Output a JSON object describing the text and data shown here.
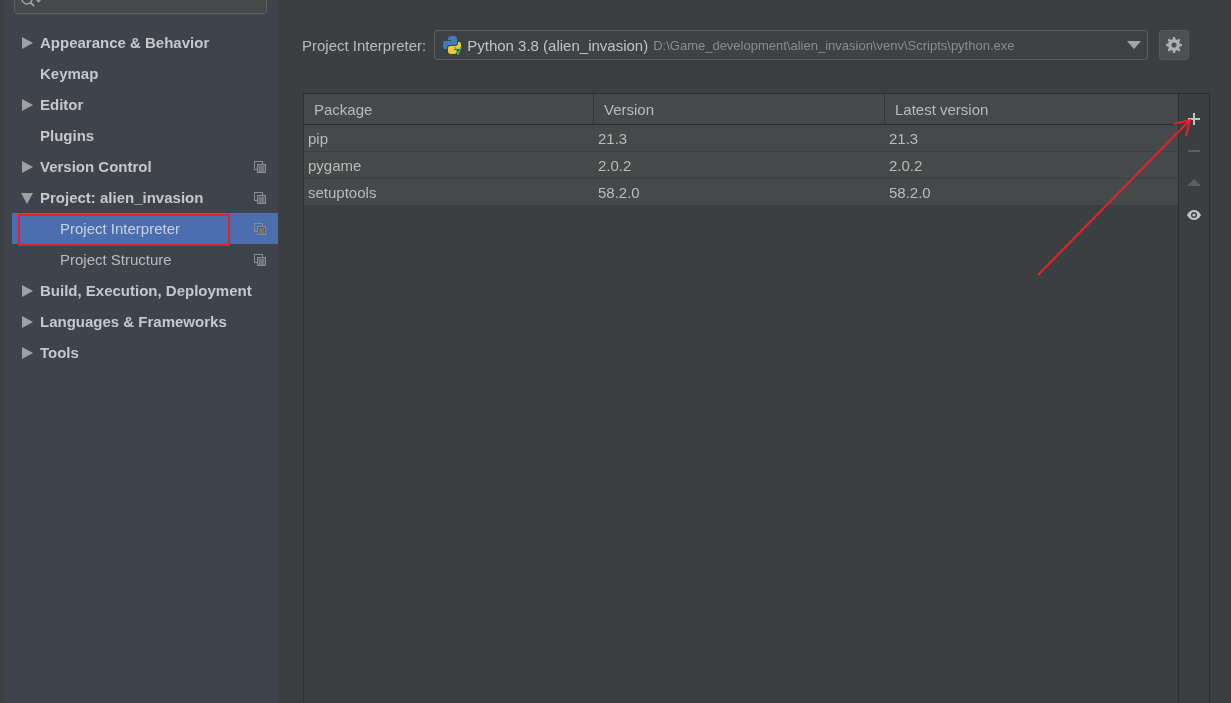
{
  "sidebar": {
    "items": [
      {
        "label": "Appearance & Behavior",
        "kind": "group",
        "expanded": false,
        "selected": false,
        "scoped": false
      },
      {
        "label": "Keymap",
        "kind": "page",
        "selected": false,
        "scoped": false
      },
      {
        "label": "Editor",
        "kind": "group",
        "expanded": false,
        "selected": false,
        "scoped": false
      },
      {
        "label": "Plugins",
        "kind": "page",
        "selected": false,
        "scoped": false
      },
      {
        "label": "Version Control",
        "kind": "group",
        "expanded": false,
        "selected": false,
        "scoped": true
      },
      {
        "label": "Project: alien_invasion",
        "kind": "group",
        "expanded": true,
        "selected": false,
        "scoped": true,
        "children": [
          {
            "label": "Project Interpreter",
            "kind": "page",
            "selected": true,
            "scoped": true
          },
          {
            "label": "Project Structure",
            "kind": "page",
            "selected": false,
            "scoped": true
          }
        ]
      },
      {
        "label": "Build, Execution, Deployment",
        "kind": "group",
        "expanded": false,
        "selected": false,
        "scoped": false
      },
      {
        "label": "Languages & Frameworks",
        "kind": "group",
        "expanded": false,
        "selected": false,
        "scoped": false
      },
      {
        "label": "Tools",
        "kind": "group",
        "expanded": false,
        "selected": false,
        "scoped": false
      }
    ]
  },
  "interpreter": {
    "label": "Project Interpreter:",
    "name": "Python 3.8 (alien_invasion)",
    "path": "D:\\Game_development\\alien_invasion\\venv\\Scripts\\python.exe"
  },
  "table": {
    "columns": [
      "Package",
      "Version",
      "Latest version"
    ],
    "rows": [
      [
        "pip",
        "21.3",
        "21.3"
      ],
      [
        "pygame",
        "2.0.2",
        "2.0.2"
      ],
      [
        "setuptools",
        "58.2.0",
        "58.2.0"
      ]
    ]
  },
  "toolbar": [
    {
      "kind": "add",
      "disabled": false
    },
    {
      "kind": "remove",
      "disabled": true
    },
    {
      "kind": "up",
      "disabled": true
    },
    {
      "kind": "show",
      "disabled": false
    }
  ],
  "annotations": {
    "frame": true,
    "arrow": true
  }
}
